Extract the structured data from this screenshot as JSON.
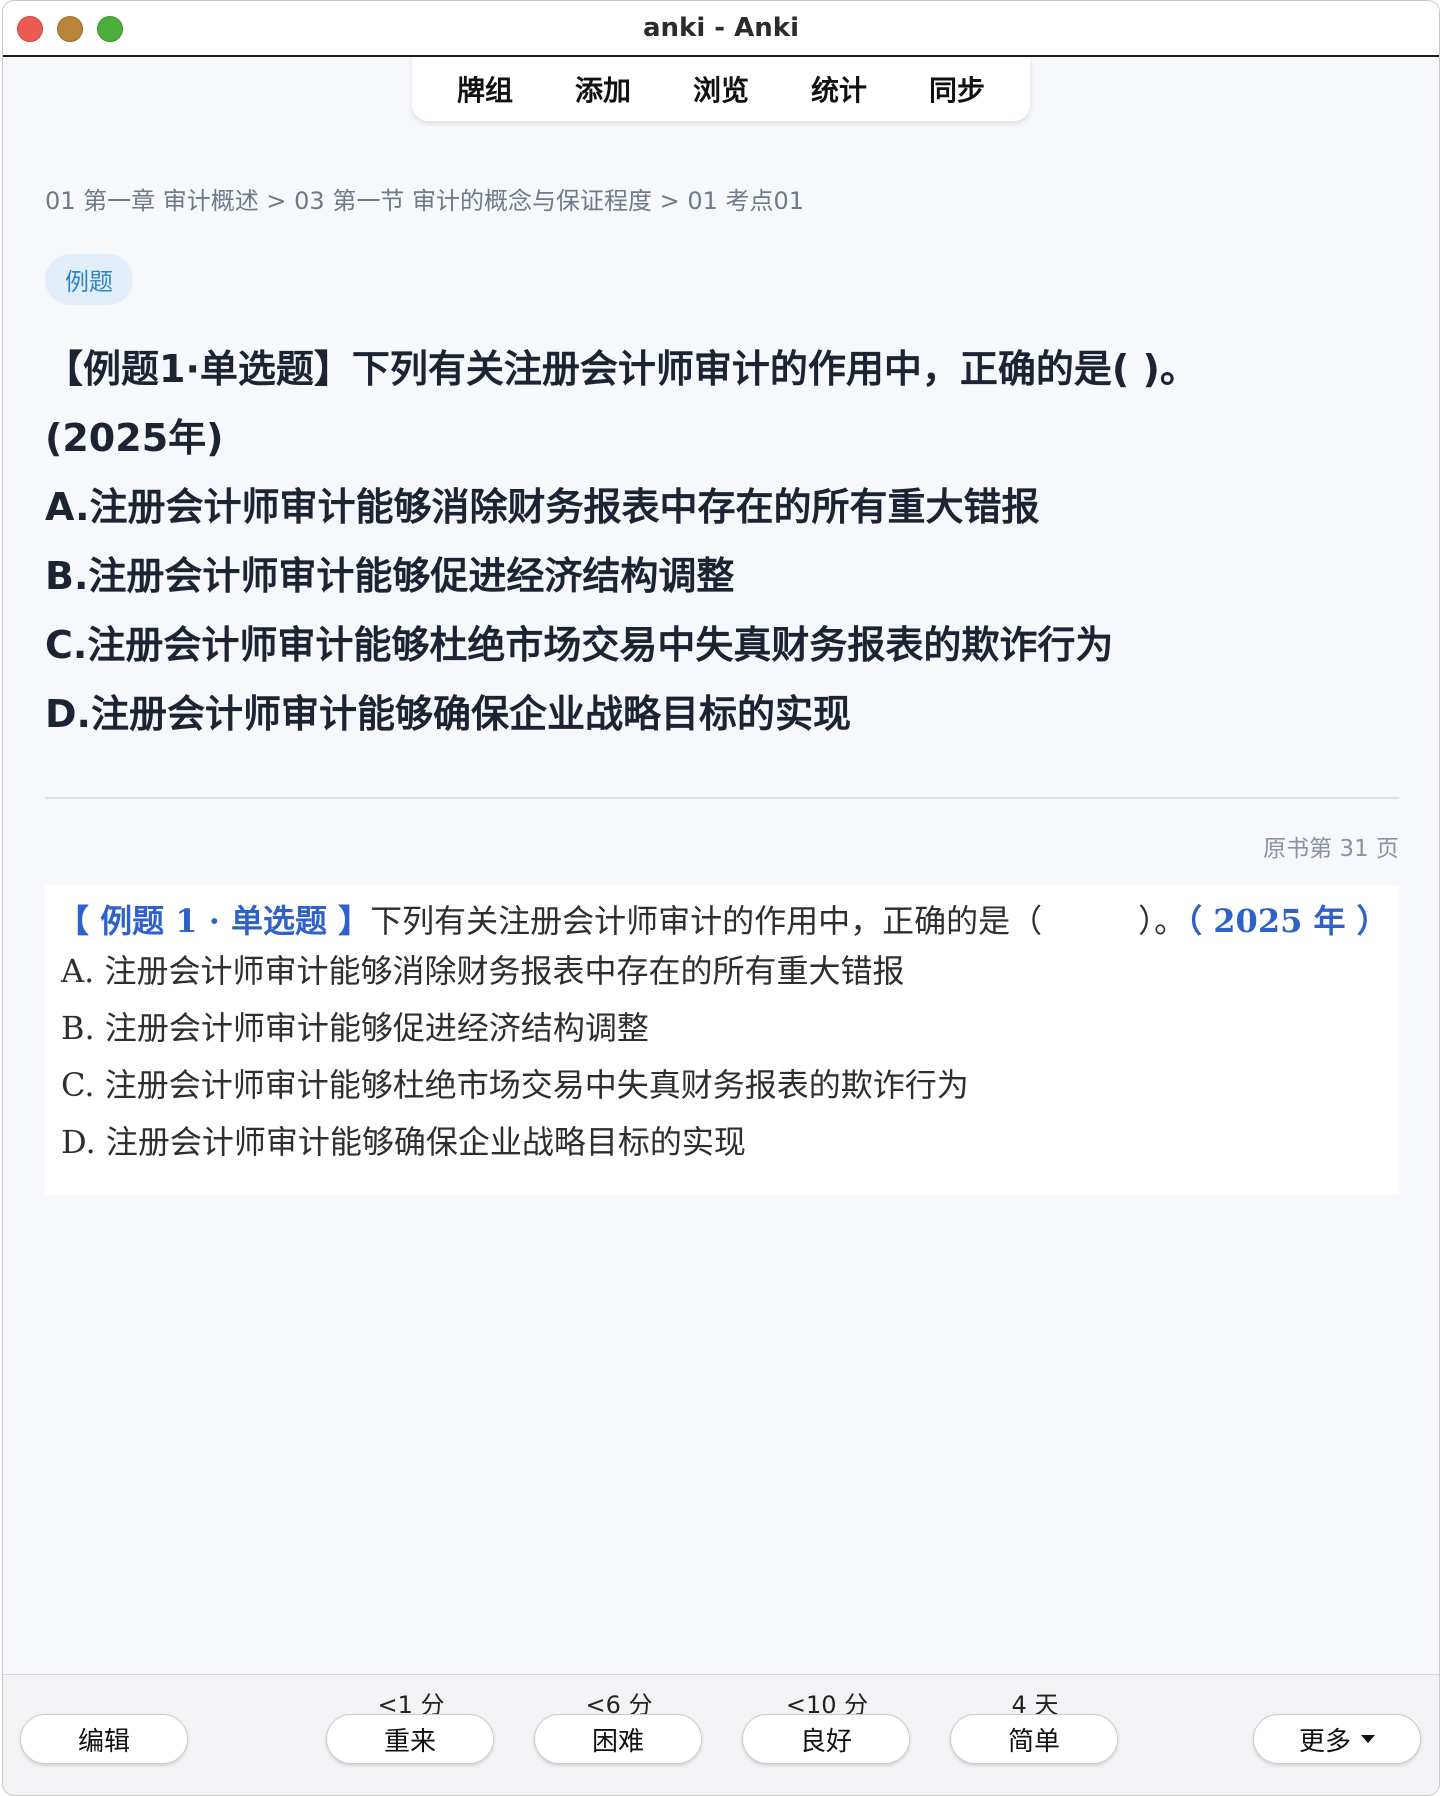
{
  "window": {
    "title": "anki - Anki"
  },
  "topnav": {
    "items": [
      "牌组",
      "添加",
      "浏览",
      "统计",
      "同步"
    ]
  },
  "card": {
    "breadcrumb": "01 第一章 审计概述 > 03 第一节 审计的概念与保证程度 > 01 考点01",
    "tag": "例题",
    "question_lines": [
      "【例题1·单选题】下列有关注册会计师审计的作用中，正确的是( )。",
      "(2025年)",
      "A.注册会计师审计能够消除财务报表中存在的所有重大错报",
      "B.注册会计师审计能够促进经济结构调整",
      "C.注册会计师审计能够杜绝市场交易中失真财务报表的欺诈行为",
      "D.注册会计师审计能够确保企业战略目标的实现"
    ],
    "page_ref": "原书第 31 页",
    "scan": {
      "head_label": "【 例题 1 · 单选题 】",
      "head_text": "下列有关注册会计师审计的作用中，正确的是（　　　）。",
      "head_year": "（ 2025 年 ）",
      "options": [
        "A. 注册会计师审计能够消除财务报表中存在的所有重大错报",
        "B. 注册会计师审计能够促进经济结构调整",
        "C. 注册会计师审计能够杜绝市场交易中失真财务报表的欺诈行为",
        "D. 注册会计师审计能够确保企业战略目标的实现"
      ]
    }
  },
  "bottombar": {
    "edit_label": "编辑",
    "more_label": "更多",
    "answers": [
      {
        "eta": "<1 分",
        "label": "重来"
      },
      {
        "eta": "<6 分",
        "label": "困难"
      },
      {
        "eta": "<10 分",
        "label": "良好"
      },
      {
        "eta": "4 天",
        "label": "简单"
      }
    ]
  }
}
